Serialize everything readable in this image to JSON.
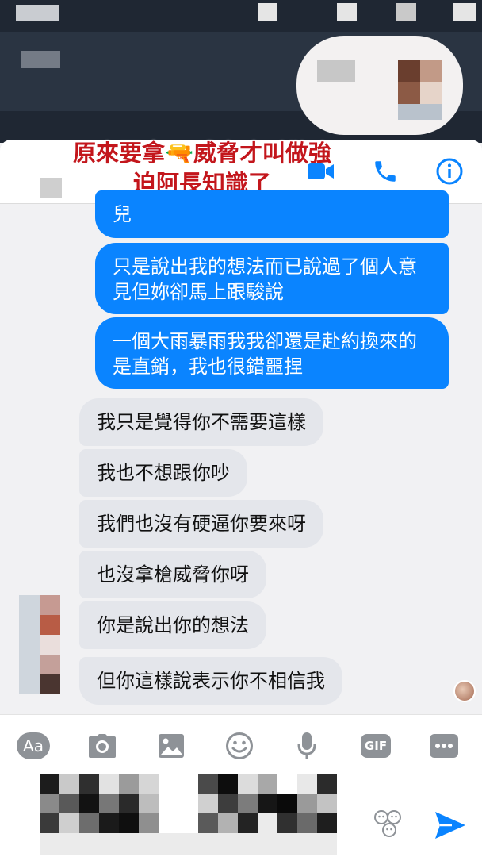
{
  "overlay_caption": "原來要拿🔫威脅才叫做強迫阿長知識了",
  "overlay_caption_line1": "原來要拿🔫威脅才叫做強",
  "overlay_caption_line2": "迫阿長知識了",
  "header": {
    "icons": [
      "video-call-icon",
      "phone-icon",
      "info-icon"
    ],
    "accent_color": "#0a84ff"
  },
  "messages": [
    {
      "sender": "me",
      "text": "兒"
    },
    {
      "sender": "me",
      "text": "只是說出我的想法而已說過了個人意見但妳卻馬上跟駿說"
    },
    {
      "sender": "me",
      "text": "一個大雨暴雨我我卻還是赴約換來的是直銷，我也很錯噩捏"
    },
    {
      "sender": "them",
      "text": "我只是覺得你不需要這樣"
    },
    {
      "sender": "them",
      "text": "我也不想跟你吵"
    },
    {
      "sender": "them",
      "text": "我們也沒有硬逼你要來呀"
    },
    {
      "sender": "them",
      "text": "也沒拿槍威脅你呀"
    },
    {
      "sender": "them",
      "text": "你是說出你的想法"
    },
    {
      "sender": "them",
      "text": "但你這樣說表示你不相信我"
    }
  ],
  "composer": {
    "text_mode_label": "Aa",
    "gif_label": "GIF",
    "icons": [
      "text-mode-icon",
      "camera-icon",
      "gallery-icon",
      "emoji-icon",
      "microphone-icon",
      "gif-icon",
      "more-icon",
      "sticker-icon",
      "send-icon"
    ],
    "icon_color": "#8e9297",
    "send_color": "#0a84ff"
  }
}
